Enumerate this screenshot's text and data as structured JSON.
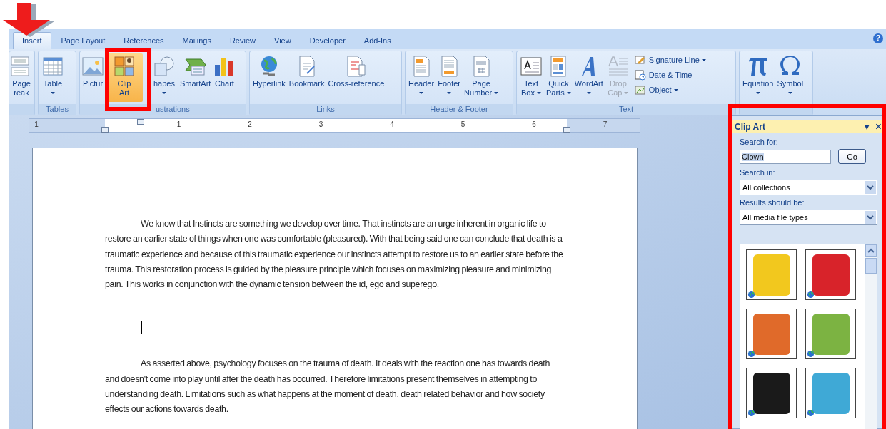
{
  "ribbon": {
    "tabs": [
      {
        "label": "Insert",
        "selected": true
      },
      {
        "label": "Page Layout",
        "selected": false
      },
      {
        "label": "References",
        "selected": false
      },
      {
        "label": "Mailings",
        "selected": false
      },
      {
        "label": "Review",
        "selected": false
      },
      {
        "label": "View",
        "selected": false
      },
      {
        "label": "Developer",
        "selected": false
      },
      {
        "label": "Add-Ins",
        "selected": false
      }
    ],
    "help_glyph": "?",
    "groups": [
      {
        "items": [
          {
            "kind": "page-break",
            "lines": [
              "Page",
              "reak"
            ],
            "dropdown": false,
            "selected": false,
            "disabled": false
          }
        ]
      },
      {
        "label": "Tables",
        "items": [
          {
            "kind": "table",
            "lines": [
              "Table"
            ],
            "dropdown": true,
            "selected": false,
            "disabled": false
          }
        ]
      },
      {
        "label": "ustrations",
        "items": [
          {
            "kind": "picture",
            "lines": [
              "Pictur"
            ],
            "dropdown": false,
            "selected": false,
            "disabled": false
          },
          {
            "kind": "clipart",
            "lines": [
              "Clip",
              "Art"
            ],
            "dropdown": false,
            "selected": true,
            "disabled": false
          },
          {
            "kind": "shapes",
            "lines": [
              "hapes"
            ],
            "dropdown": true,
            "selected": false,
            "disabled": false
          },
          {
            "kind": "smartart",
            "lines": [
              "SmartArt"
            ],
            "dropdown": false,
            "selected": false,
            "disabled": false
          },
          {
            "kind": "chart",
            "lines": [
              "Chart"
            ],
            "dropdown": false,
            "selected": false,
            "disabled": false
          }
        ]
      },
      {
        "label": "Links",
        "items": [
          {
            "kind": "hyperlink",
            "lines": [
              "Hyperlink"
            ],
            "dropdown": false,
            "selected": false,
            "disabled": false
          },
          {
            "kind": "bookmark",
            "lines": [
              "Bookmark"
            ],
            "dropdown": false,
            "selected": false,
            "disabled": false
          },
          {
            "kind": "crossref",
            "lines": [
              "Cross-reference"
            ],
            "dropdown": false,
            "selected": false,
            "disabled": false
          }
        ]
      },
      {
        "label": "Header & Footer",
        "items": [
          {
            "kind": "header",
            "lines": [
              "Header"
            ],
            "dropdown": true,
            "selected": false,
            "disabled": false
          },
          {
            "kind": "footer",
            "lines": [
              "Footer"
            ],
            "dropdown": true,
            "selected": false,
            "disabled": false
          },
          {
            "kind": "pagenumber",
            "lines": [
              "Page",
              "Number"
            ],
            "dropdown": true,
            "selected": false,
            "disabled": false
          }
        ]
      },
      {
        "label": "Text",
        "items": [
          {
            "kind": "textbox",
            "lines": [
              "Text",
              "Box"
            ],
            "dropdown": true,
            "selected": false,
            "disabled": false
          },
          {
            "kind": "quickparts",
            "lines": [
              "Quick",
              "Parts"
            ],
            "dropdown": true,
            "selected": false,
            "disabled": false
          },
          {
            "kind": "wordart",
            "lines": [
              "WordArt"
            ],
            "dropdown": true,
            "selected": false,
            "disabled": false
          },
          {
            "kind": "dropcap",
            "lines": [
              "Drop",
              "Cap"
            ],
            "dropdown": true,
            "selected": false,
            "disabled": true
          }
        ],
        "small_items": [
          {
            "kind": "signature",
            "lines": [
              "Signature Line"
            ],
            "dropdown": true,
            "selected": false,
            "disabled": false
          },
          {
            "kind": "datetime",
            "lines": [
              "Date & Time"
            ],
            "dropdown": false,
            "selected": false,
            "disabled": false
          },
          {
            "kind": "object",
            "lines": [
              "Object"
            ],
            "dropdown": true,
            "selected": false,
            "disabled": false
          }
        ]
      },
      {
        "items": [
          {
            "kind": "equation",
            "lines": [
              "Equation"
            ],
            "dropdown": true,
            "selected": false,
            "disabled": false
          },
          {
            "kind": "symbol",
            "lines": [
              "Symbol"
            ],
            "dropdown": true,
            "selected": false,
            "disabled": false
          }
        ]
      }
    ]
  },
  "ruler": {
    "numbers": [
      "1",
      "1",
      "2",
      "3",
      "4",
      "5",
      "6",
      "7"
    ]
  },
  "document": {
    "blocks": [
      {
        "kind": "paragraph",
        "text": "We know that Instincts are something we develop over time. That instincts are an  urge inherent in organic life to restore an earlier state of things when one was comfortable (pleasured). With that being said one can conclude that death is a  traumatic experience and because of this traumatic experience our instincts attempt to restore us to an earlier state before the trauma. This restoration process is guided by the pleasure principle which focuses on maximizing pleasure and minimizing pain. This works in  conjunction with the dynamic tension between the id, ego and superego."
      },
      {
        "kind": "cursor"
      },
      {
        "kind": "paragraph",
        "text": "As asserted above, psychology focuses on the trauma of death. It deals with the reaction one has towards death and doesn't come into play until after the death has occurred.  Therefore limitations present themselves in attempting to understanding death.  Limitations such as what happens at the moment of death, death related behavior and how society effects our actions towards death."
      }
    ]
  },
  "task_pane": {
    "title": "Clip Art",
    "menu_glyph": "▼",
    "close_glyph": "×",
    "search_label": "Search for:",
    "search_value": "Clown",
    "go_label": "Go",
    "search_in_label": "Search in:",
    "search_in_value": "All collections",
    "results_type_label": "Results should be:",
    "results_type_value": "All media file types",
    "results": [
      {
        "color": "#f2c81e"
      },
      {
        "color": "#d8232a"
      },
      {
        "color": "#e06a2a"
      },
      {
        "color": "#7cb342"
      },
      {
        "color": "#1a1a1a"
      },
      {
        "color": "#3fa9d6"
      }
    ]
  }
}
